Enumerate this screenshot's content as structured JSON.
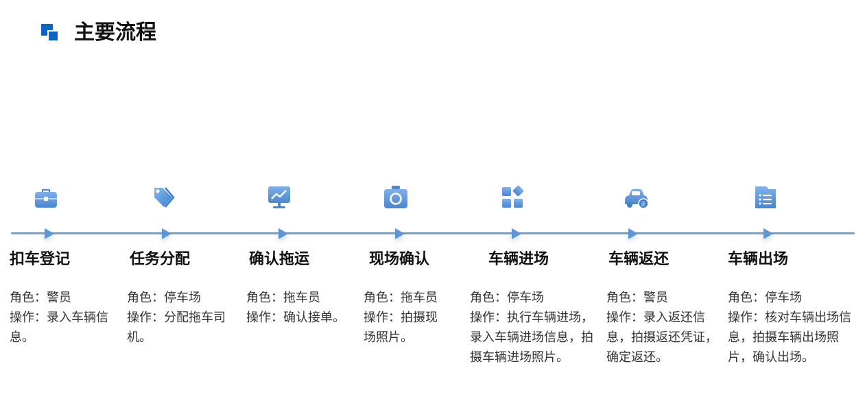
{
  "title": "主要流程",
  "colors": {
    "accent": "#0b63c4",
    "line": "#6f9fd6",
    "icon": "#5b95d9"
  },
  "steps": [
    {
      "title": "扣车登记",
      "role": "角色：警员",
      "operation": "操作：录入车辆信息。",
      "icon": "briefcase-icon"
    },
    {
      "title": "任务分配",
      "role": "角色：停车场",
      "operation": "操作：分配拖车司机。",
      "icon": "tag-icon"
    },
    {
      "title": "确认拖运",
      "role": "角色：拖车员",
      "operation": "操作：确认接单。",
      "icon": "monitor-chart-icon"
    },
    {
      "title": "现场确认",
      "role": "角色：拖车员",
      "operation": "操作：拍摄现场照片。",
      "icon": "camera-icon"
    },
    {
      "title": "车辆进场",
      "role": "角色：停车场",
      "operation": "操作：执行车辆进场，录入车辆进场信息，拍摄车辆进场照片。",
      "icon": "apps-grid-icon"
    },
    {
      "title": "车辆返还",
      "role": "角色：警员",
      "operation": "操作：录入返还信息，拍摄返还凭证，确定返还。",
      "icon": "car-return-icon"
    },
    {
      "title": "车辆出场",
      "role": "角色：停车场",
      "operation": "操作：核对车辆出场信息，拍摄车辆出场照片，确认出场。",
      "icon": "document-list-icon"
    }
  ]
}
